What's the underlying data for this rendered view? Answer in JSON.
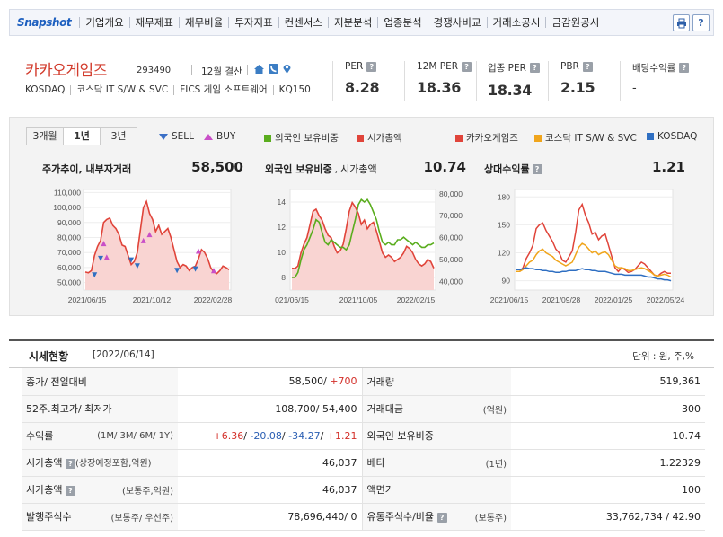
{
  "nav": {
    "logo": "Snapshot",
    "items": [
      "기업개요",
      "재무제표",
      "재무비율",
      "투자지표",
      "컨센서스",
      "지분분석",
      "업종분석",
      "경쟁사비교",
      "거래소공시",
      "금감원공시"
    ],
    "print_icon": "printer-icon",
    "help_icon": "help-icon"
  },
  "company": {
    "name": "카카오게임즈",
    "code": "293490",
    "fiscal": "12월 결산",
    "market": "KOSDAQ",
    "sector": "코스닥 IT S/W & SVC",
    "fics": "FICS 게임 소프트웨어",
    "index": "KQ150",
    "icons": [
      "home-icon",
      "phone-icon",
      "location-icon"
    ]
  },
  "metrics": [
    {
      "label": "PER",
      "value": "8.28"
    },
    {
      "label": "12M PER",
      "value": "18.36"
    },
    {
      "label": "업종 PER",
      "value": "18.34"
    },
    {
      "label": "PBR",
      "value": "2.15"
    },
    {
      "label": "배당수익률",
      "value": "-"
    }
  ],
  "chart_controls": {
    "tabs": [
      "3개월",
      "1년",
      "3년"
    ],
    "active_tab": "1년",
    "sell": "SELL",
    "buy": "BUY",
    "foreign": "외국인 보유비중",
    "mcap": "시가총액",
    "rel_company": "카카오게임즈",
    "rel_sector": "코스닥 IT S/W & SVC",
    "rel_kosdaq": "KOSDAQ"
  },
  "colors": {
    "red": "#e0443a",
    "green": "#5aad1e",
    "orange": "#f0a51c",
    "blue": "#2f6fc2",
    "fill": "#f9d4d2"
  },
  "chart_data": [
    {
      "type": "line",
      "title": "주가추이, 내부자거래",
      "value_label": "58,500",
      "x_ticks": [
        "2021/06/15",
        "2021/10/12",
        "2022/02/28"
      ],
      "y_ticks": [
        "110,000",
        "100,000",
        "90,000",
        "80,000",
        "70,000",
        "60,000",
        "50,000"
      ],
      "ylim": [
        45000,
        112000
      ],
      "series": [
        {
          "values": [
            57000,
            56500,
            58000,
            68000,
            74000,
            78000,
            90000,
            92000,
            93000,
            88000,
            86000,
            82000,
            75000,
            74000,
            68000,
            62000,
            64000,
            70000,
            85000,
            100000,
            104000,
            96000,
            92000,
            84000,
            88000,
            82000,
            84000,
            86000,
            80000,
            72000,
            64000,
            60000,
            62000,
            61000,
            58000,
            60000,
            61000,
            66000,
            72000,
            70000,
            66000,
            60000,
            57000,
            56000,
            58000,
            61000,
            60000,
            58500
          ]
        }
      ],
      "sell_marks": [
        [
          3,
          55000
        ],
        [
          5,
          66000
        ],
        [
          15,
          65000
        ],
        [
          17,
          61000
        ],
        [
          30,
          58000
        ],
        [
          36,
          59000
        ]
      ],
      "buy_marks": [
        [
          6,
          76000
        ],
        [
          7,
          67000
        ],
        [
          19,
          78000
        ],
        [
          21,
          82000
        ],
        [
          37,
          71000
        ],
        [
          42,
          58000
        ]
      ]
    },
    {
      "type": "line",
      "title": "외국인 보유비중",
      "title2": "시가총액",
      "value_label": "10.74",
      "x_ticks": [
        "021/06/15",
        "2021/10/05",
        "2022/02/15"
      ],
      "y_ticks_left": [
        "14",
        "12",
        "10",
        "8"
      ],
      "y_ticks_right": [
        "80,000",
        "70,000",
        "60,000",
        "50,000",
        "40,000"
      ],
      "ylim_left": [
        7,
        15
      ],
      "ylim_right": [
        36000,
        82000
      ],
      "series": [
        {
          "name": "외국인 보유비중",
          "values": [
            8.0,
            8.0,
            8.4,
            9.4,
            10.2,
            10.6,
            11.2,
            11.8,
            12.6,
            12.4,
            11.6,
            10.8,
            10.6,
            11.0,
            10.8,
            10.6,
            10.4,
            10.4,
            10.2,
            10.6,
            11.6,
            12.6,
            13.8,
            14.2,
            14.0,
            14.2,
            13.8,
            13.2,
            12.6,
            11.6,
            10.8,
            10.6,
            10.8,
            10.6,
            10.6,
            11.0,
            11.0,
            11.2,
            11.0,
            10.8,
            10.6,
            10.8,
            10.6,
            10.4,
            10.4,
            10.6,
            10.6,
            10.74
          ]
        },
        {
          "name": "시가총액",
          "values": [
            46000,
            45800,
            47000,
            53000,
            57000,
            60000,
            66000,
            72000,
            73000,
            70000,
            68000,
            64000,
            61000,
            60000,
            56000,
            53000,
            54000,
            57000,
            64000,
            72000,
            76000,
            74000,
            71000,
            66000,
            68000,
            64000,
            66000,
            67000,
            63000,
            58000,
            53000,
            51000,
            52000,
            51000,
            49000,
            50000,
            51000,
            53000,
            56000,
            55000,
            53000,
            50000,
            48000,
            47000,
            48000,
            50000,
            49000,
            46037
          ]
        }
      ]
    },
    {
      "type": "line",
      "title": "상대수익률",
      "value_label": "1.21",
      "x_ticks": [
        "2021/06/15",
        "2021/09/28",
        "2022/01/25",
        "2022/05/24"
      ],
      "y_ticks": [
        "180",
        "150",
        "120",
        "90"
      ],
      "ylim": [
        80,
        188
      ],
      "series": [
        {
          "name": "카카오게임즈",
          "values": [
            100,
            100,
            104,
            114,
            120,
            128,
            146,
            150,
            152,
            144,
            138,
            132,
            124,
            120,
            112,
            110,
            116,
            122,
            142,
            166,
            172,
            160,
            152,
            140,
            142,
            134,
            138,
            140,
            128,
            116,
            104,
            100,
            104,
            102,
            99,
            100,
            102,
            106,
            110,
            108,
            104,
            100,
            96,
            95,
            98,
            100,
            98,
            98
          ]
        },
        {
          "name": "코스닥 IT S/W & SVC",
          "values": [
            100,
            100,
            102,
            106,
            110,
            112,
            118,
            122,
            124,
            120,
            118,
            116,
            112,
            110,
            108,
            106,
            108,
            110,
            118,
            126,
            130,
            128,
            124,
            120,
            122,
            118,
            120,
            121,
            118,
            112,
            106,
            104,
            104,
            103,
            101,
            101,
            102,
            103,
            104,
            103,
            101,
            99,
            96,
            95,
            96,
            97,
            96,
            94
          ]
        },
        {
          "name": "KOSDAQ",
          "values": [
            102,
            102,
            103,
            104,
            103,
            103,
            102,
            102,
            101,
            101,
            100,
            100,
            99,
            99,
            100,
            100,
            101,
            101,
            101,
            102,
            103,
            102,
            102,
            101,
            101,
            100,
            100,
            100,
            99,
            98,
            97,
            97,
            97,
            96,
            96,
            96,
            96,
            96,
            96,
            95,
            94,
            94,
            93,
            92,
            92,
            91,
            91,
            90
          ]
        }
      ]
    }
  ],
  "section": {
    "title": "시세현황",
    "date": "[2022/06/14]",
    "unit": "단위 : 원, 주,%"
  },
  "quote": {
    "price_label": "종가/ 전일대비",
    "price": "58,500/ ",
    "price_change": "+700",
    "range_label": "52주.최고가/ 최저가",
    "range": "108,700/ 54,400",
    "return_label": "수익률",
    "return_sub": "(1M/ 3M/ 6M/ 1Y)",
    "return_1m": "+6.36",
    "return_3m": "-20.08",
    "return_6m": "-34.27",
    "return_1y": "+1.21",
    "mcap1_label": "시가총액",
    "mcap1_sub": "(상장예정포함,억원)",
    "mcap1": "46,037",
    "mcap2_label": "시가총액",
    "mcap2_sub": "(보통주,억원)",
    "mcap2": "46,037",
    "shares_label": "발행주식수",
    "shares_sub": "(보통주/ 우선주)",
    "shares": "78,696,440/ 0",
    "volume_label": "거래량",
    "volume": "519,361",
    "amount_label": "거래대금",
    "amount_sub": "(억원)",
    "amount": "300",
    "foreign_label": "외국인 보유비중",
    "foreign": "10.74",
    "beta_label": "베타",
    "beta_sub": "(1년)",
    "beta": "1.22329",
    "par_label": "액면가",
    "par": "100",
    "float_label": "유통주식수/비율",
    "float_sub": "(보통주)",
    "float": "33,762,734 / 42.90"
  }
}
